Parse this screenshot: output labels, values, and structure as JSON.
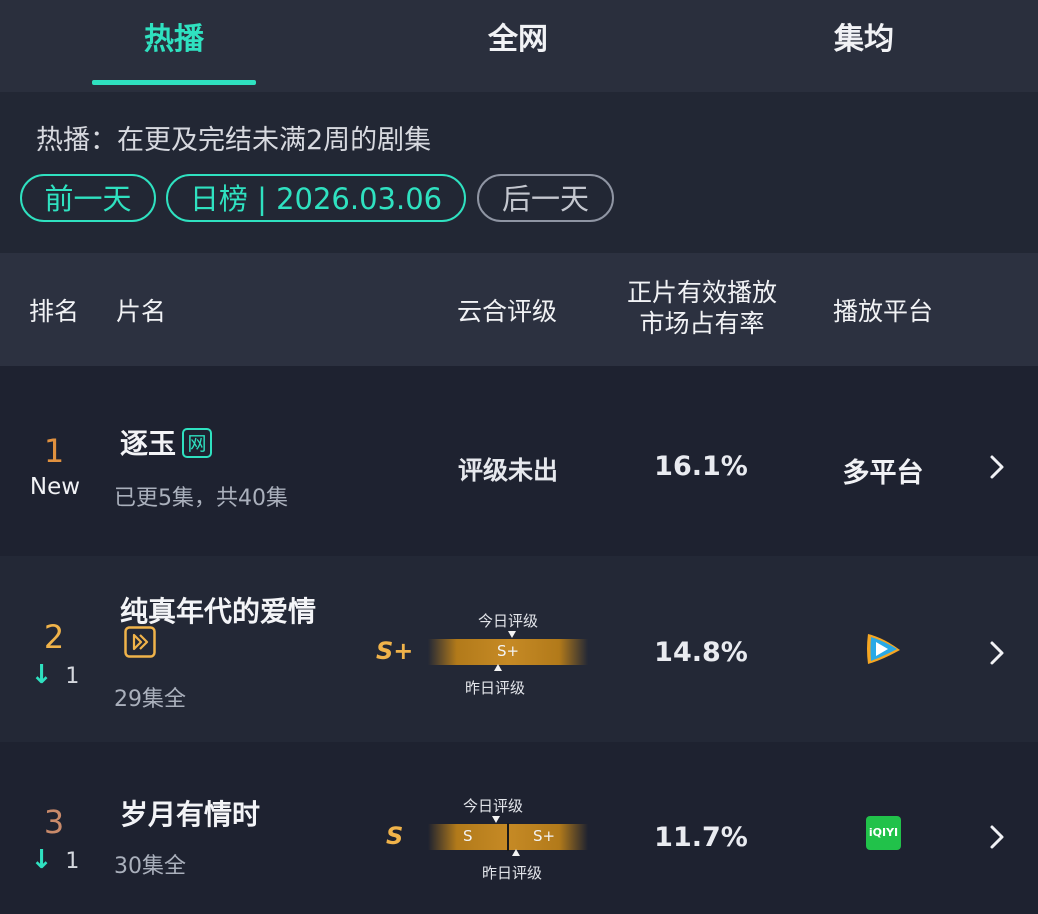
{
  "tabs": [
    {
      "label": "热播",
      "active": true
    },
    {
      "label": "全网",
      "active": false
    },
    {
      "label": "集均",
      "active": false
    }
  ],
  "description": "热播：在更及完结未满2周的剧集",
  "date_nav": {
    "prev_label": "前一天",
    "current_label": "日榜 | 2026.03.06",
    "next_label": "后一天"
  },
  "table_header": {
    "rank": "排名",
    "title": "片名",
    "grade": "云合评级",
    "share_line1": "正片有效播放",
    "share_line2": "市场占有率",
    "platform": "播放平台"
  },
  "rows": [
    {
      "rank": "1",
      "rank_change": "New",
      "rank_color": "#e0913f",
      "title": "逐玉",
      "tag": "网",
      "episodes": "已更5集，共40集",
      "grade": "评级未出",
      "share": "16.1%",
      "platform": "多平台",
      "platform_icon": "multi-platform-text"
    },
    {
      "rank": "2",
      "rank_change_arrow": "↓",
      "rank_change": "1",
      "rank_color": "#f0b34a",
      "title": "纯真年代的爱情",
      "tag_icon": "play-tag-icon",
      "episodes": "29集全",
      "grade_letter": "S+",
      "today_label": "今日评级",
      "yesterday_label": "昨日评级",
      "bar_labels": [
        "S+"
      ],
      "share": "14.8%",
      "platform_icon": "tencent-video-icon"
    },
    {
      "rank": "3",
      "rank_change_arrow": "↓",
      "rank_change": "1",
      "rank_color": "#c98a6a",
      "title": "岁月有情时",
      "episodes": "30集全",
      "grade_letter": "S",
      "today_label": "今日评级",
      "yesterday_label": "昨日评级",
      "bar_labels": [
        "S",
        "S+"
      ],
      "share": "11.7%",
      "platform_icon": "iqiyi-icon",
      "platform_icon_text": "iQIYI"
    }
  ],
  "colors": {
    "accent": "#2fe1c0",
    "grade_gold": "#f0b34a",
    "down_arrow": "#2fe1c0"
  }
}
